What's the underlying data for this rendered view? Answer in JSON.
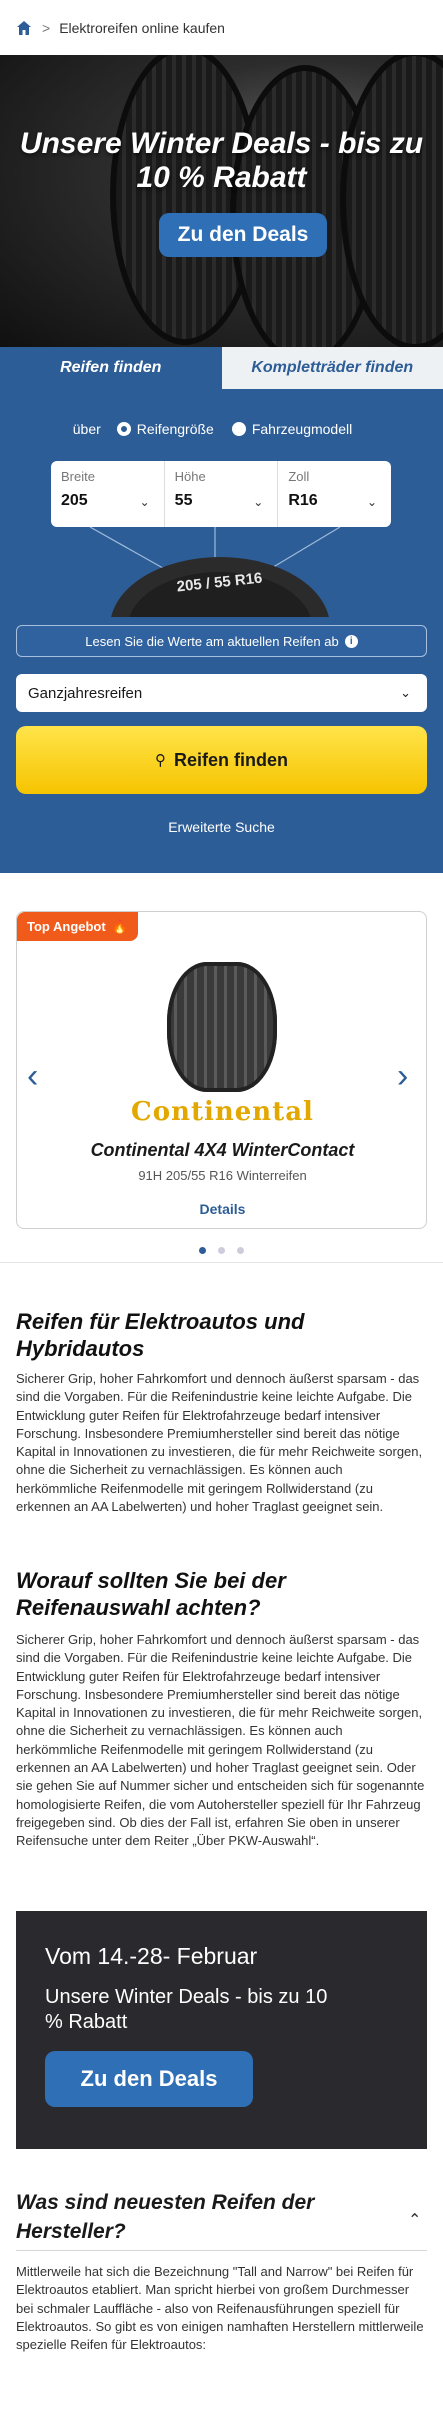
{
  "breadcrumb": {
    "current": "Elektroreifen online kaufen",
    "separator": ">"
  },
  "hero": {
    "title": "Unsere Winter Deals - bis zu 10 % Rabatt",
    "button": "Zu den Deals"
  },
  "tabs": [
    {
      "label": "Reifen finden",
      "active": true
    },
    {
      "label": "Kompletträder finden",
      "active": false
    }
  ],
  "finder": {
    "via_label": "über",
    "radio": [
      {
        "label": "Reifengröße",
        "selected": true
      },
      {
        "label": "Fahrzeugmodell",
        "selected": false
      }
    ],
    "selects": [
      {
        "label": "Breite",
        "value": "205"
      },
      {
        "label": "Höhe",
        "value": "55"
      },
      {
        "label": "Zoll",
        "value": "R16"
      }
    ],
    "tire_marking": "205 / 55 R16",
    "read_hint": "Lesen Sie die Werte am aktuellen Reifen ab",
    "info_symbol": "i",
    "season": "Ganzjahresreifen",
    "search_button": "Reifen finden",
    "advanced": "Erweiterte Suche"
  },
  "offer": {
    "badge": "Top Angebot",
    "brand": "Continental",
    "name": "Continental 4X4 WinterContact",
    "spec": "91H 205/55 R16 Winterreifen",
    "details": "Details",
    "dots": 3,
    "active_dot": 0
  },
  "sections": [
    {
      "heading": "Reifen für Elektroautos und Hybridautos",
      "text": "Sicherer Grip, hoher Fahrkomfort und dennoch äußerst sparsam - das sind die Vorgaben. Für die Reifenindustrie keine leichte Aufgabe. Die Entwicklung guter Reifen für Elektrofahrzeuge bedarf intensiver Forschung. Insbesondere Premiumhersteller sind bereit das nötige Kapital in Innovationen zu investieren, die für mehr Reichweite sorgen, ohne die Sicherheit zu vernachlässigen. Es können auch herkömmliche Reifenmodelle mit geringem Rollwiderstand (zu erkennen an AA Labelwerten) und hoher Traglast geeignet sein."
    },
    {
      "heading": "Worauf sollten Sie bei der Reifenauswahl achten?",
      "text": "Sicherer Grip, hoher Fahrkomfort und dennoch äußerst sparsam - das sind die Vorgaben. Für die Reifenindustrie keine leichte Aufgabe. Die Entwicklung guter Reifen für Elektrofahrzeuge bedarf intensiver Forschung. Insbesondere Premiumhersteller sind bereit das nötige Kapital in Innovationen zu investieren, die für mehr Reichweite sorgen, ohne die Sicherheit zu vernachlässigen. Es können auch herkömmliche Reifenmodelle mit geringem Rollwiderstand (zu erkennen an AA Labelwerten) und hoher Traglast geeignet sein. Oder sie gehen Sie auf Nummer sicher und entscheiden sich für sogenannte homologisierte Reifen, die vom Autohersteller speziell für Ihr Fahrzeug freigegeben sind. Ob dies der Fall ist, erfahren Sie oben in unserer Reifensuche unter dem Reiter „Über PKW-Auswahl“."
    }
  ],
  "promo": {
    "date": "Vom 14.-28- Februar",
    "text": "Unsere Winter Deals - bis zu 10 % Rabatt",
    "button": "Zu den Deals"
  },
  "faq": {
    "question": "Was sind neuesten Reifen der Hersteller?",
    "answer": "Mittlerweile hat sich die Bezeichnung \"Tall and Narrow\" bei Reifen für Elektroautos etabliert. Man spricht hierbei von großem Durchmesser bei schmaler Lauffläche - also von Reifenausführungen speziell für Elektroautos. So gibt es von einigen namhaften Herstellern mittlerweile spezielle Reifen für Elektroautos:"
  }
}
